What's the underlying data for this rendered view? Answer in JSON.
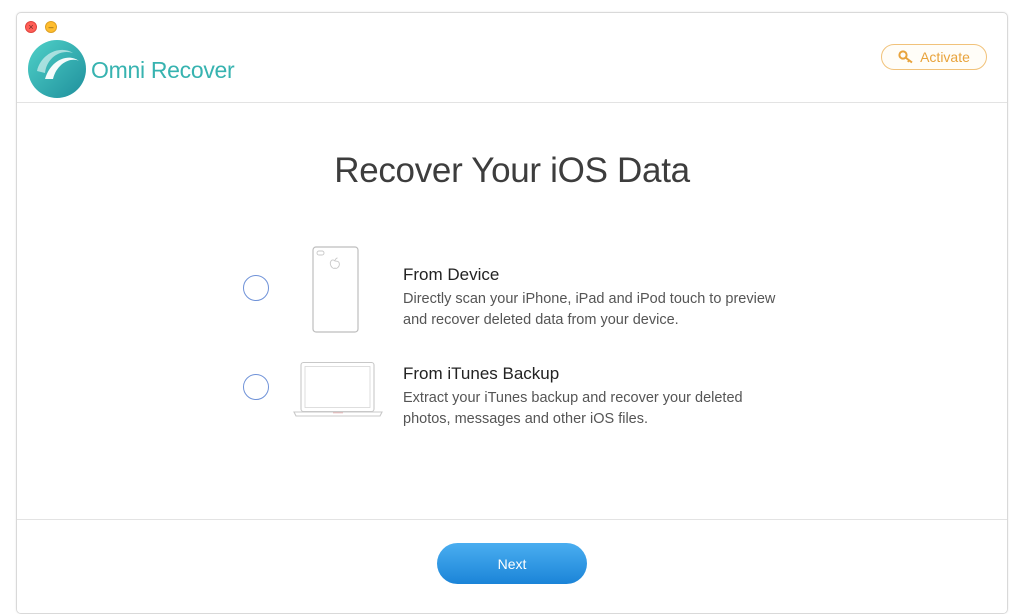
{
  "app": {
    "name": "Omni Recover",
    "brand_color": "#37b3b0"
  },
  "header": {
    "activate_label": "Activate",
    "activate_icon": "key-icon",
    "activate_color": "#e8a33c"
  },
  "main": {
    "title": "Recover Your iOS Data",
    "options": [
      {
        "title": "From Device",
        "description": "Directly scan your iPhone, iPad and iPod touch to preview and recover deleted data from your device.",
        "icon": "iphone-icon",
        "selected": false
      },
      {
        "title": "From iTunes Backup",
        "description": "Extract your iTunes backup and recover your deleted photos, messages and other iOS files.",
        "icon": "laptop-icon",
        "selected": false
      }
    ]
  },
  "footer": {
    "next_label": "Next",
    "accent": "#1b84d8"
  }
}
